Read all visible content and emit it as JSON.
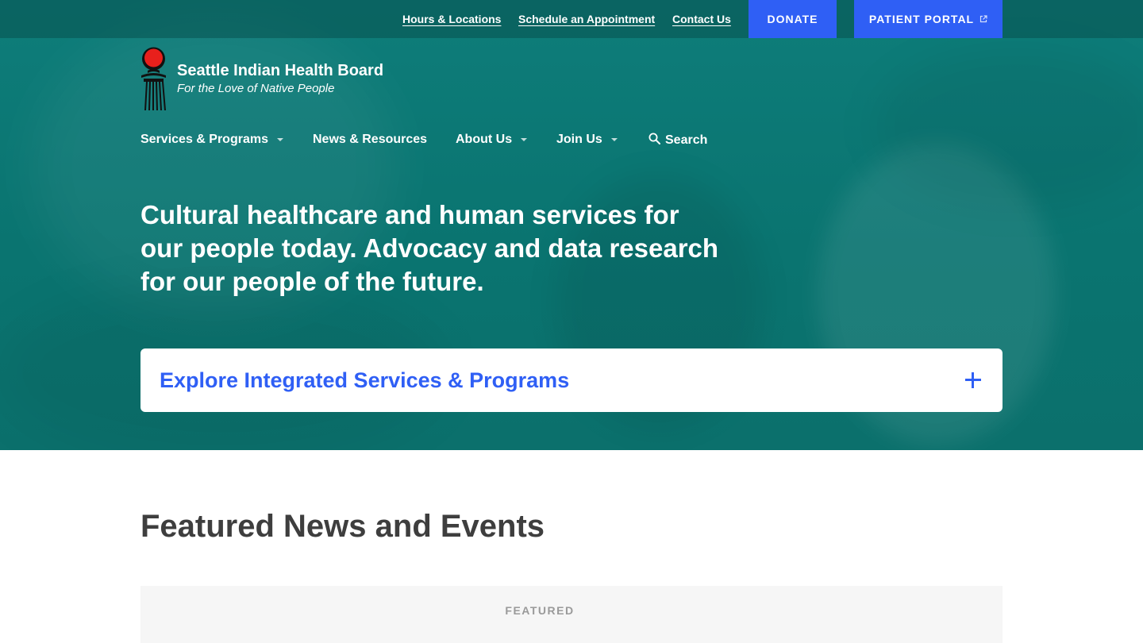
{
  "utility_nav": {
    "links": [
      "Hours & Locations",
      "Schedule an Appointment",
      "Contact Us"
    ],
    "donate": "DONATE",
    "patient_portal": "PATIENT PORTAL"
  },
  "brand": {
    "name": "Seattle Indian Health Board",
    "tagline": "For the Love of Native People"
  },
  "main_nav": {
    "items": [
      "Services & Programs",
      "News & Resources",
      "About Us",
      "Join Us"
    ],
    "search": "Search"
  },
  "hero": {
    "headline": "Cultural healthcare and human services for our people today. Advocacy and data research for our people of the future.",
    "explore_label": "Explore Integrated Services & Programs"
  },
  "featured": {
    "title": "Featured News and Events",
    "card_label": "FEATURED"
  },
  "colors": {
    "teal": "#0a7470",
    "accent_blue": "#2f5ff5",
    "logo_red": "#e8201c"
  },
  "icons": [
    "external-link-icon",
    "chevron-down-icon",
    "search-icon",
    "plus-icon"
  ]
}
